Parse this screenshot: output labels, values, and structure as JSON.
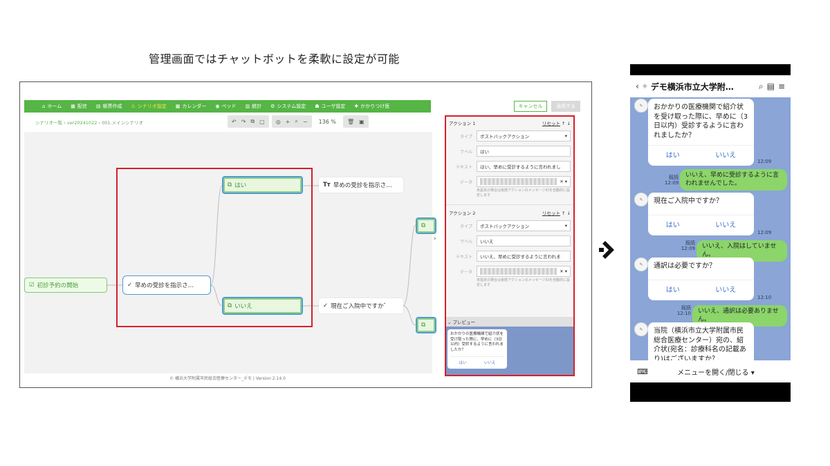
{
  "slide_title": "管理画面ではチャットボットを柔軟に設定が可能",
  "admin": {
    "nav": [
      {
        "icon": "home-icon",
        "glyph": "⌂",
        "label": "ホーム"
      },
      {
        "icon": "calendar-icon",
        "glyph": "▦",
        "label": "配信"
      },
      {
        "icon": "form-icon",
        "glyph": "▤",
        "label": "帳票作成"
      },
      {
        "icon": "warning-icon",
        "glyph": "⚠",
        "label": "シナリオ設定"
      },
      {
        "icon": "calendar-icon",
        "glyph": "▦",
        "label": "カレンダー"
      },
      {
        "icon": "bed-icon",
        "glyph": "◉",
        "label": "ベッド"
      },
      {
        "icon": "stats-icon",
        "glyph": "▥",
        "label": "統計"
      },
      {
        "icon": "gear-icon",
        "glyph": "⚙",
        "label": "システム設定"
      },
      {
        "icon": "user-icon",
        "glyph": "☗",
        "label": "ユーザ設定"
      },
      {
        "icon": "hospital-icon",
        "glyph": "✚",
        "label": "かかりつけ医"
      }
    ],
    "cancel_label": "キャンセル",
    "apply_label": "適用する",
    "breadcrumb_root": "シナリオ一覧",
    "breadcrumb_ver": "ver20241022",
    "breadcrumb_leaf": "001.メインシナリオ",
    "zoom": "136 %",
    "nodes": {
      "start": "初診予約の開始",
      "question": "早めの受診を指示さ…",
      "yes": "はい",
      "no": "いいえ",
      "text_result": "早めの受診を指示さ…",
      "next_question": "現在ご入院中ですか゛"
    },
    "footer": "© 横浜大学附属市民総合医療センター_デモ | Version 2.14.0",
    "panel": {
      "actions": [
        {
          "title": "アクション 1",
          "reset": "リセット",
          "type_label": "タイプ",
          "type_value": "ポストバックアクション",
          "label_label": "ラベル",
          "label_value": "はい",
          "text_label": "テキスト",
          "text_value": "はい、早めに受診するように言われまし",
          "data_label": "データ",
          "note": "未設定の場合は後続アクションのメッセージIDを自動的に設定します"
        },
        {
          "title": "アクション 2",
          "reset": "リセット",
          "type_label": "タイプ",
          "type_value": "ポストバックアクション",
          "label_label": "ラベル",
          "label_value": "いいえ",
          "text_label": "テキスト",
          "text_value": "いいえ、早めに受診するように言われま",
          "data_label": "データ",
          "note": "未指定の場合は後続アクションのメッセージIDを自動的に設定します"
        }
      ],
      "preview_title": "プレビュー",
      "preview_text": "おかかりの医療機関で紹介状を受け取った際に、早めに（3日以内）受診するように言われましたか？",
      "preview_yes": "はい",
      "preview_no": "いいえ"
    }
  },
  "phone": {
    "title": "デモ横浜市立大学附…",
    "menu": "メニューを開く/閉じる ▾",
    "messages": [
      {
        "q": "おかかりの医療機関で紹介状を受け取った際に、早めに（3日以内）受診するように言われましたか？",
        "yes": "はい",
        "no": "いいえ",
        "time": "12:09"
      },
      {
        "reply": "いいえ、早めに受診するように言われませんでした。",
        "read": "既読",
        "time": "12:09"
      },
      {
        "q": "現在ご入院中ですか？",
        "yes": "はい",
        "no": "いいえ",
        "time": "12:09"
      },
      {
        "reply": "いいえ、入院はしていません。",
        "read": "既読",
        "time": "12:09"
      },
      {
        "q": "通訳は必要ですか？",
        "yes": "はい",
        "no": "いいえ",
        "time": "12:10"
      },
      {
        "reply": "いいえ、通訳は必要ありません。",
        "read": "既読",
        "time": "12:10"
      },
      {
        "q": "当院（横浜市立大学附属市民総合医療センター）宛の、紹介状(宛名：診療科名の記載あり)はございますか？"
      }
    ]
  }
}
